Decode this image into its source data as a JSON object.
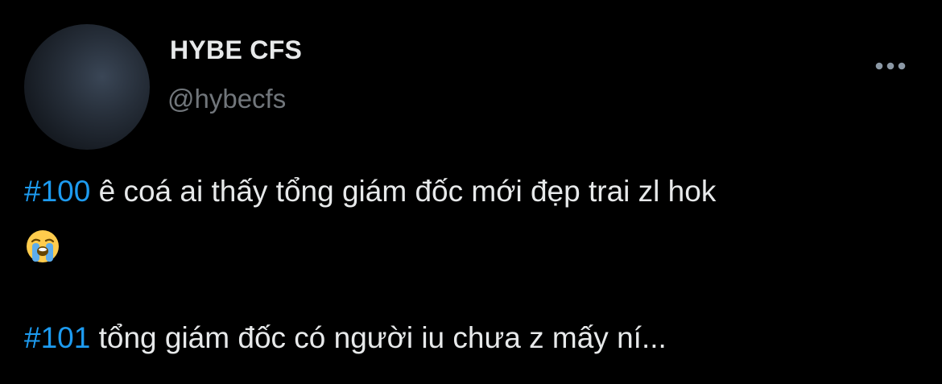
{
  "author": {
    "name": "HYBE CFS",
    "handle": "@hybecfs"
  },
  "tweet": {
    "line1_hashtag": "#100",
    "line1_text": " ê coá ai thấy tổng giám đốc mới đẹp trai zl hok",
    "emoji": "loudly-crying-face",
    "line2_hashtag": "#101",
    "line2_text": " tổng giám đốc có người iu chưa z mấy ní..."
  },
  "icons": {
    "more": "more-horizontal-icon"
  },
  "colors": {
    "background": "#000000",
    "primary_text": "#e7e9ea",
    "secondary_text": "#71767b",
    "hashtag": "#1d9bf0"
  }
}
